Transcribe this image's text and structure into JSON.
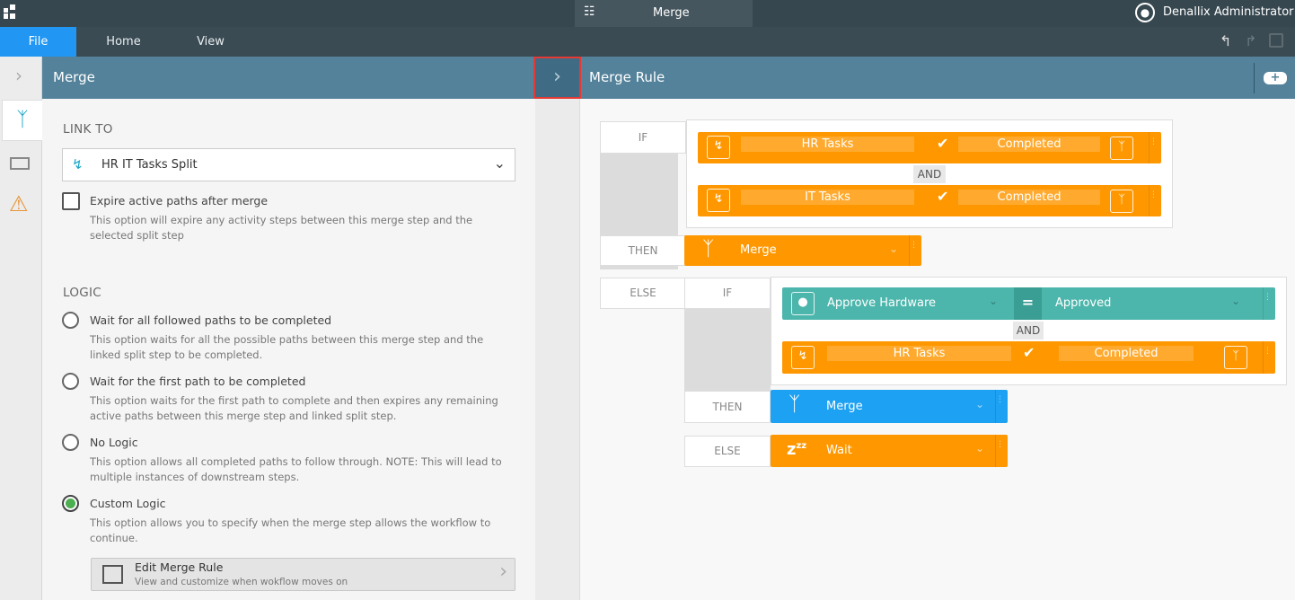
{
  "topbar": {
    "window_tab": "Merge",
    "user": "Denallix Administrator"
  },
  "ribbon": {
    "tabs": [
      "File",
      "Home",
      "View"
    ]
  },
  "left_panel": {
    "title": "Merge",
    "link_to_label": "LINK TO",
    "link_to_value": "HR IT Tasks Split",
    "expire_label": "Expire active paths after merge",
    "expire_desc": "This option will expire any activity steps between this merge step and the selected split step",
    "logic_label": "LOGIC",
    "options": [
      {
        "label": "Wait for all followed paths to be completed",
        "desc": "This option waits for all the possible paths between this merge step and the linked split step to be completed.",
        "selected": false
      },
      {
        "label": "Wait for the first path to be completed",
        "desc": "This option waits for the first path to complete and then expires any remaining active paths between this merge step and linked split step.",
        "selected": false
      },
      {
        "label": "No Logic",
        "desc": "This option allows all completed paths to follow through. NOTE: This will lead to multiple instances of downstream steps.",
        "selected": false
      },
      {
        "label": "Custom Logic",
        "desc": "This option allows you to specify when the merge step allows the workflow to continue.",
        "selected": true
      }
    ],
    "edit_button": {
      "title": "Edit Merge Rule",
      "subtitle": "View and customize when wokflow moves on"
    }
  },
  "rule": {
    "title": "Merge Rule",
    "if": "IF",
    "then": "THEN",
    "else": "ELSE",
    "and": "AND",
    "cond1": {
      "left": "HR Tasks",
      "right": "Completed"
    },
    "cond2": {
      "left": "IT Tasks",
      "right": "Completed"
    },
    "then1": "Merge",
    "cond3": {
      "left": "Approve Hardware",
      "right": "Approved"
    },
    "cond4": {
      "left": "HR Tasks",
      "right": "Completed"
    },
    "then2": "Merge",
    "else2": "Wait"
  },
  "colors": {
    "orange": "#ff9800",
    "teal": "#4db6ac",
    "blue": "#1da1f2",
    "header": "#53829a"
  }
}
